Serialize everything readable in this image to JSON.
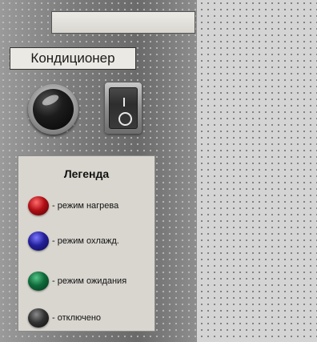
{
  "panel": {
    "top_field_value": "",
    "title": "Кондиционер",
    "indicator_state": "отключено",
    "switch_state": "off"
  },
  "legend": {
    "title": "Легенда",
    "items": [
      {
        "label": "- режим нагрева",
        "color": "#b01016",
        "icon": "red-led-icon"
      },
      {
        "label": "- режим охлажд.",
        "color": "#24209a",
        "icon": "blue-led-icon"
      },
      {
        "label": "- режим ожидания",
        "color": "#0f6a3a",
        "icon": "green-led-icon"
      },
      {
        "label": "- отключено",
        "color": "#333333",
        "icon": "black-led-icon"
      }
    ]
  }
}
